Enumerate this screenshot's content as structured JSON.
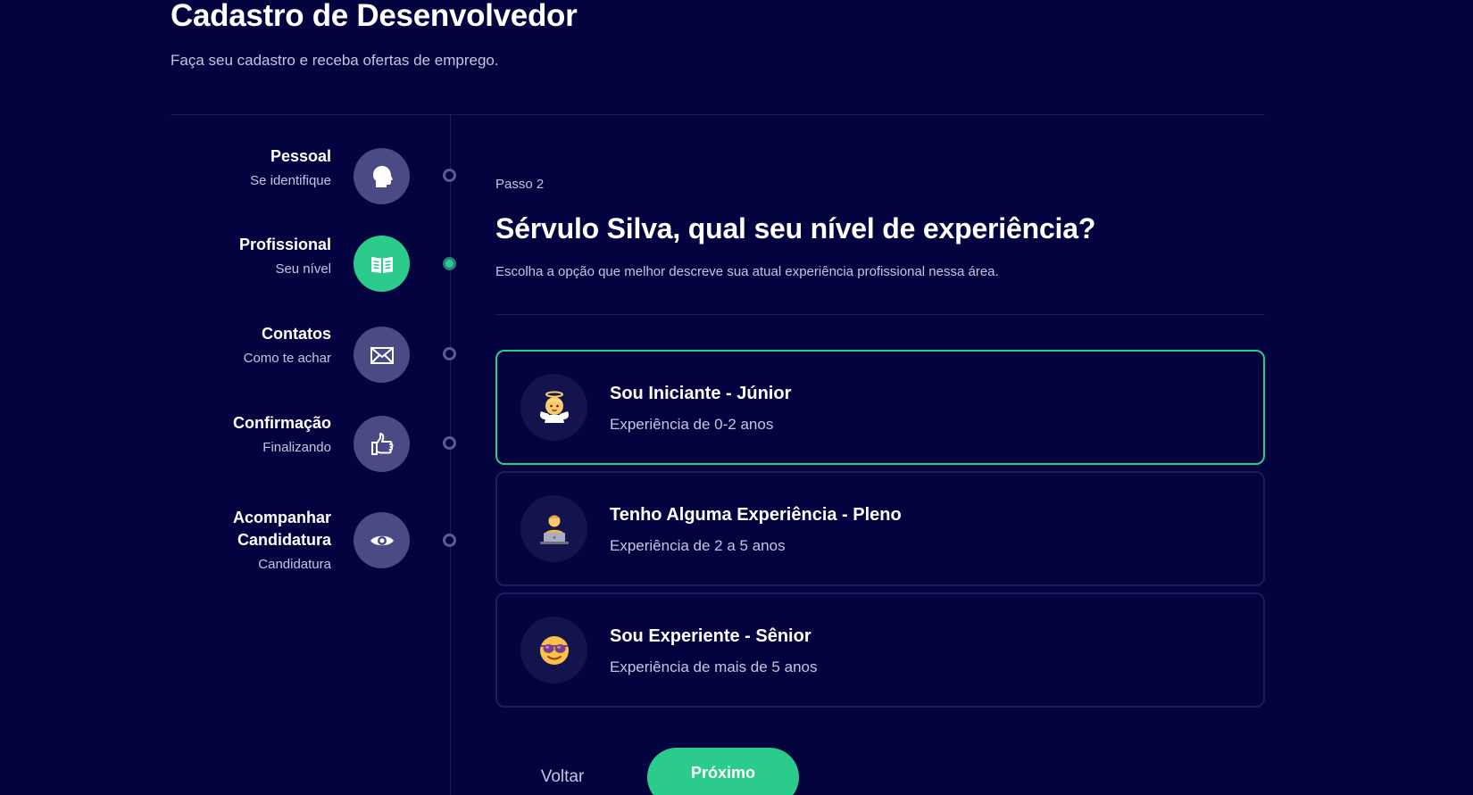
{
  "header": {
    "title": "Cadastro de Desenvolvedor",
    "subtitle": "Faça seu cadastro e receba ofertas de emprego."
  },
  "steps": [
    {
      "title": "Pessoal",
      "subtitle": "Se identifique",
      "icon": "head-icon",
      "active": false
    },
    {
      "title": "Profissional",
      "subtitle": "Seu nível",
      "icon": "book-icon",
      "active": true
    },
    {
      "title": "Contatos",
      "subtitle": "Como te achar",
      "icon": "envelope-icon",
      "active": false
    },
    {
      "title": "Confirmação",
      "subtitle": "Finalizando",
      "icon": "thumbs-up-icon",
      "active": false
    },
    {
      "title_line1": "Acompanhar",
      "title_line2": "Candidatura",
      "subtitle": "Candidatura",
      "icon": "eye-icon",
      "active": false
    }
  ],
  "main": {
    "step_label": "Passo 2",
    "question": "Sérvulo Silva, qual seu nível de experiência?",
    "description": "Escolha a opção que melhor descreve sua atual experiência profissional nessa área."
  },
  "options": [
    {
      "title": "Sou Iniciante - Júnior",
      "subtitle": "Experiência de 0-2 anos",
      "icon": "baby-angel-icon",
      "selected": true
    },
    {
      "title": "Tenho Alguma Experiência - Pleno",
      "subtitle": "Experiência de 2 a 5 anos",
      "icon": "technologist-icon",
      "selected": false
    },
    {
      "title": "Sou Experiente - Sênior",
      "subtitle": "Experiência de mais de 5 anos",
      "icon": "sunglasses-face-icon",
      "selected": false
    }
  ],
  "actions": {
    "back_label": "Voltar",
    "next_label": "Próximo"
  },
  "colors": {
    "background": "#03033f",
    "accent": "#2bcb8c",
    "step_inactive": "#4a4a85",
    "muted_text": "#c3c6e0",
    "divider": "#1a1c5c"
  }
}
